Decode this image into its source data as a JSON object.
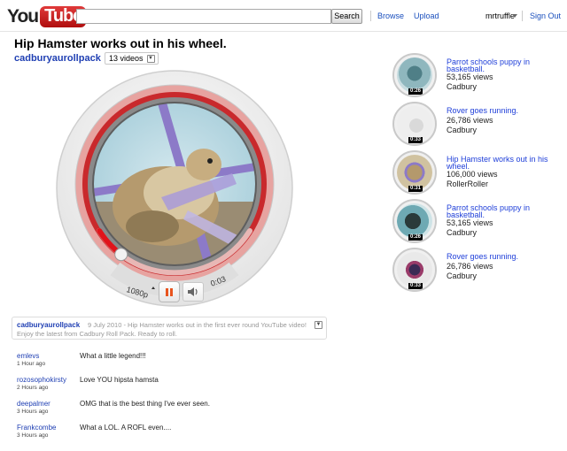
{
  "header": {
    "logo_you": "You",
    "logo_tube": "Tube",
    "search_value": "",
    "search_button": "Search",
    "browse": "Browse",
    "upload": "Upload",
    "username": "mrtruffle",
    "sign_out": "Sign Out"
  },
  "video": {
    "title": "Hip Hamster works out in his wheel.",
    "channel": "cadburyaurollpack",
    "video_count": "13 videos",
    "quality": "1080p",
    "current_time": "0:03",
    "progress": 0.18
  },
  "related": [
    {
      "title": "Parrot schools puppy in basketball.",
      "views": "53,165 views",
      "author": "Cadbury",
      "duration": "0:26",
      "thumb": "parrot"
    },
    {
      "title": "Rover goes running.",
      "views": "26,786 views",
      "author": "Cadbury",
      "duration": "0:33",
      "thumb": "rover"
    },
    {
      "title": "Hip Hamster works out in his wheel.",
      "views": "106,000 views",
      "author": "RollerRoller",
      "duration": "0:31",
      "thumb": "hamster"
    },
    {
      "title": "Parrot schools puppy in basketball.",
      "views": "53,165 views",
      "author": "Cadbury",
      "duration": "0:26",
      "thumb": "puppy"
    },
    {
      "title": "Rover goes running.",
      "views": "26,786 views",
      "author": "Cadbury",
      "duration": "0:33",
      "thumb": "rover2"
    }
  ],
  "description": {
    "channel": "cadburyaurollpack",
    "date": "9 July 2010",
    "text": "9 July 2010 -  Hip Hamster works out in the first ever round YouTube video! Enjoy the latest from Cadbury Roll Pack. Ready to roll."
  },
  "comments": [
    {
      "user": "emlevs",
      "time": "1 Hour ago",
      "text": "What a little legend!!!"
    },
    {
      "user": "rozosophokirsty",
      "time": "2 Hours ago",
      "text": "Love YOU hipsta hamsta"
    },
    {
      "user": "deepalmer",
      "time": "3 Hours ago",
      "text": "OMG that is the best thing I've ever seen."
    },
    {
      "user": "Frankcombe",
      "time": "3 Hours ago",
      "text": "What a LOL. A ROFL even...."
    }
  ],
  "colors": {
    "link_blue": "#1f3fd9",
    "accent_red": "#d9342b",
    "pause_orange": "#e8541e"
  },
  "icons": {
    "pause": "pause-icon",
    "volume": "volume-icon",
    "expand": "chevron-down-icon"
  }
}
